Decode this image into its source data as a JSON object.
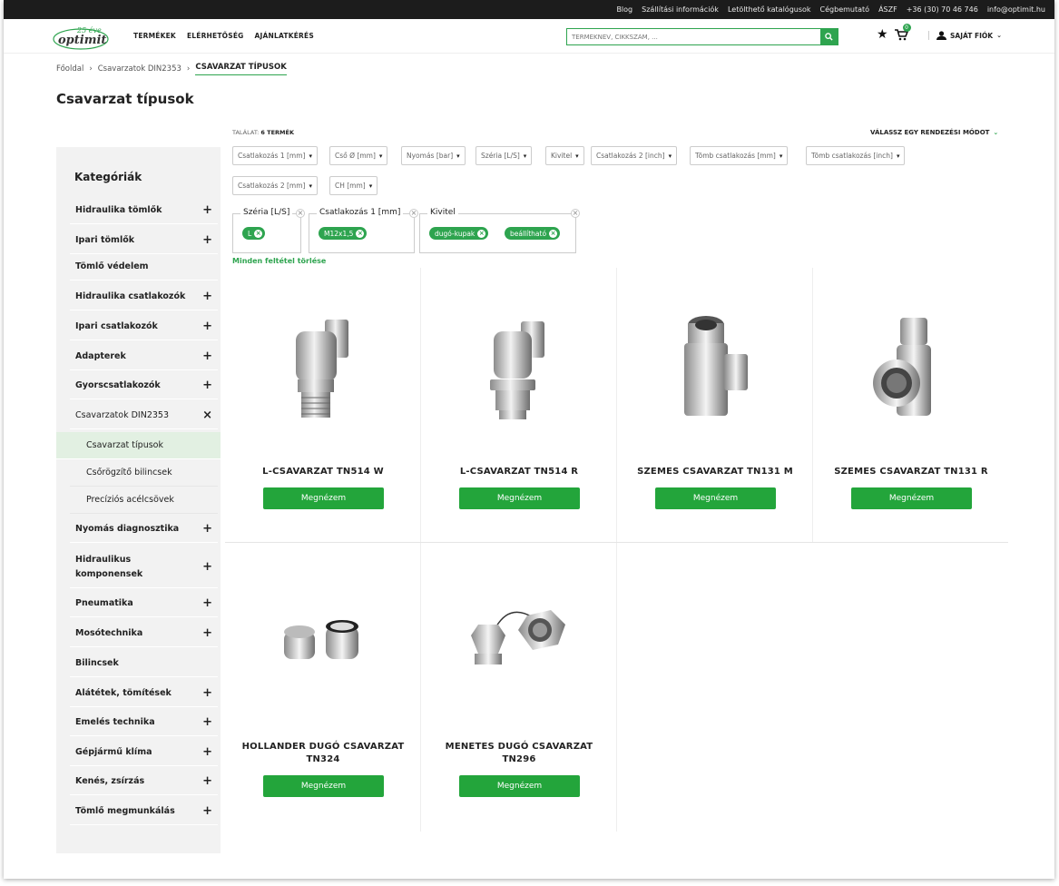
{
  "topbar": {
    "links": [
      "Blog",
      "Szállítási információk",
      "Letölthető katalógusok",
      "Cégbemutató",
      "ÁSZF",
      "+36 (30) 70 46 746",
      "info@optimit.hu"
    ]
  },
  "header": {
    "logo_text": "optimit",
    "logo_badge": "25 éve",
    "nav": [
      "TERMÉKEK",
      "ELÉRHETŐSÉG",
      "AJÁNLATKÉRÉS"
    ],
    "search_placeholder": "TERMÉKNÉV, CIKKSZÁM, ...",
    "cart_count": "0",
    "account_label": "SAJÁT FIÓK"
  },
  "breadcrumb": [
    "Főoldal",
    "Csavarzatok DIN2353",
    "CSAVARZAT TÍPUSOK"
  ],
  "page_title": "Csavarzat típusok",
  "sidebar": {
    "title": "Kategóriák",
    "items": [
      {
        "label": "Hidraulika tömlők",
        "icon": "+"
      },
      {
        "label": "Ipari tömlők",
        "icon": "+"
      },
      {
        "label": "Tömlő védelem",
        "icon": ""
      },
      {
        "label": "Hidraulika csatlakozók",
        "icon": "+"
      },
      {
        "label": "Ipari csatlakozók",
        "icon": "+"
      },
      {
        "label": "Adapterek",
        "icon": "+"
      },
      {
        "label": "Gyorscsatlakozók",
        "icon": "+"
      },
      {
        "label": "Csavarzatok DIN2353",
        "icon": "×"
      },
      {
        "label": "Csavarzat típusok",
        "icon": ""
      },
      {
        "label": "Csőrögzítő bilincsek",
        "icon": ""
      },
      {
        "label": "Precíziós acélcsövek",
        "icon": ""
      },
      {
        "label": "Nyomás diagnosztika",
        "icon": "+"
      },
      {
        "label": "Hidraulikus komponensek",
        "icon": "+"
      },
      {
        "label": "Pneumatika",
        "icon": "+"
      },
      {
        "label": "Mosótechnika",
        "icon": "+"
      },
      {
        "label": "Bilincsek",
        "icon": ""
      },
      {
        "label": "Alátétek, tömítések",
        "icon": "+"
      },
      {
        "label": "Emelés technika",
        "icon": "+"
      },
      {
        "label": "Gépjármű klíma",
        "icon": "+"
      },
      {
        "label": "Kenés, zsírzás",
        "icon": "+"
      },
      {
        "label": "Tömlő megmunkálás",
        "icon": "+"
      }
    ]
  },
  "results": {
    "label": "TALÁLAT:",
    "count": "6 TERMÉK"
  },
  "sort_label": "VÁLASSZ EGY RENDEZÉSI MÓDOT",
  "filters": [
    "Csatlakozás 1 [mm]",
    "Cső Ø [mm]",
    "Nyomás [bar]",
    "Széria [L/S]",
    "Kivitel",
    "Csatlakozás 2 [inch]",
    "Tömb csatlakozás [mm]",
    "Tömb csatlakozás [inch]",
    "Csatlakozás 2 [mm]",
    "CH [mm]"
  ],
  "active_filters": [
    {
      "label": "Széria [L/S]",
      "values": [
        "L"
      ]
    },
    {
      "label": "Csatlakozás 1 [mm]",
      "values": [
        "M12x1,5"
      ]
    },
    {
      "label": "Kivitel",
      "values": [
        "dugó-kupak",
        "beállítható"
      ]
    }
  ],
  "clear_all": "Minden feltétel törlése",
  "products": [
    {
      "name": "L-CSAVARZAT TN514 W",
      "button": "Megnézem"
    },
    {
      "name": "L-CSAVARZAT TN514 R",
      "button": "Megnézem"
    },
    {
      "name": "SZEMES CSAVARZAT TN131 M",
      "button": "Megnézem"
    },
    {
      "name": "SZEMES CSAVARZAT TN131 R",
      "button": "Megnézem"
    },
    {
      "name": "HOLLANDER DUGÓ CSAVARZAT TN324",
      "button": "Megnézem"
    },
    {
      "name": "MENETES DUGÓ CSAVARZAT TN296",
      "button": "Megnézem"
    }
  ]
}
